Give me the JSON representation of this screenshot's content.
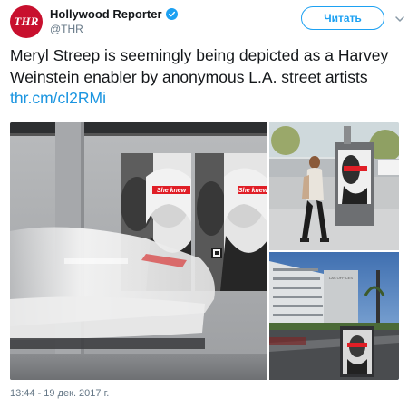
{
  "account": {
    "avatar_text": "THR",
    "display_name": "Hollywood Reporter",
    "handle": "@THR",
    "verified": true
  },
  "follow_button": {
    "label": "Читать"
  },
  "menu": {
    "icon": "chevron-down-icon"
  },
  "tweet": {
    "text": "Meryl Streep is seemingly being depicted as a Harvey Weinstein enabler by anonymous L.A. street artists",
    "link": "thr.cm/cl2RMi"
  },
  "media": {
    "poster_caption": "She knew",
    "photos": [
      "street-wall-posters",
      "woman-walking-past-poster",
      "building-billboard-street"
    ]
  },
  "timestamp": "13:44 - 19 дек. 2017 г.",
  "colors": {
    "brand_red": "#c8102e",
    "link_blue": "#1b95e0",
    "button_blue": "#1da1f2"
  }
}
